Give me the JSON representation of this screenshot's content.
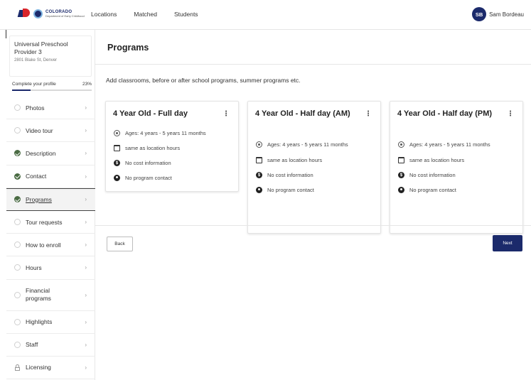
{
  "logo": {
    "title": "COLORADO",
    "subtitle": "Department of Early Childhood"
  },
  "nav": {
    "items": [
      "Locations",
      "Matched",
      "Students"
    ]
  },
  "user": {
    "initials": "SB",
    "name": "Sam Bordeau"
  },
  "provider": {
    "name": "Universal Preschool Provider 3",
    "address": "2801 Blake St, Denver"
  },
  "profile_progress": {
    "label": "Complete your profile",
    "percent_label": "23%",
    "percent": 23
  },
  "sidebar": {
    "items": [
      {
        "label": "Photos",
        "status": "incomplete"
      },
      {
        "label": "Video tour",
        "status": "incomplete"
      },
      {
        "label": "Description",
        "status": "complete"
      },
      {
        "label": "Contact",
        "status": "complete"
      },
      {
        "label": "Programs",
        "status": "complete",
        "active": true
      },
      {
        "label": "Tour requests",
        "status": "incomplete"
      },
      {
        "label": "How to enroll",
        "status": "incomplete"
      },
      {
        "label": "Hours",
        "status": "incomplete"
      },
      {
        "label": "Financial programs",
        "status": "incomplete"
      },
      {
        "label": "Highlights",
        "status": "incomplete"
      },
      {
        "label": "Staff",
        "status": "incomplete"
      },
      {
        "label": "Licensing",
        "status": "locked"
      }
    ],
    "chevron": "›"
  },
  "page": {
    "title": "Programs",
    "intro": "Add classrooms, before or after school programs, summer programs etc.",
    "kebab": "⋮"
  },
  "programs": [
    {
      "title": "4 Year Old - Full day",
      "ages": "Ages: 4 years - 5 years 11 months",
      "hours": "same as location hours",
      "cost": "No cost information",
      "contact": "No program contact"
    },
    {
      "title": "4 Year Old - Half day (AM)",
      "ages": "Ages: 4 years - 5 years 11 months",
      "hours": "same as location hours",
      "cost": "No cost information",
      "contact": "No program contact"
    },
    {
      "title": "4 Year Old - Half day (PM)",
      "ages": "Ages: 4 years - 5 years 11 months",
      "hours": "same as location hours",
      "cost": "No cost information",
      "contact": "No program contact"
    }
  ],
  "icons": {
    "ages": "eye-icon",
    "hours": "calendar-icon",
    "cost": "dollar-icon",
    "contact": "person-icon"
  },
  "actions": {
    "back": "Back",
    "next": "Next"
  },
  "colors": {
    "brand": "#1b2a6b",
    "complete": "#4a6b43",
    "accent_red": "#d8242a"
  }
}
